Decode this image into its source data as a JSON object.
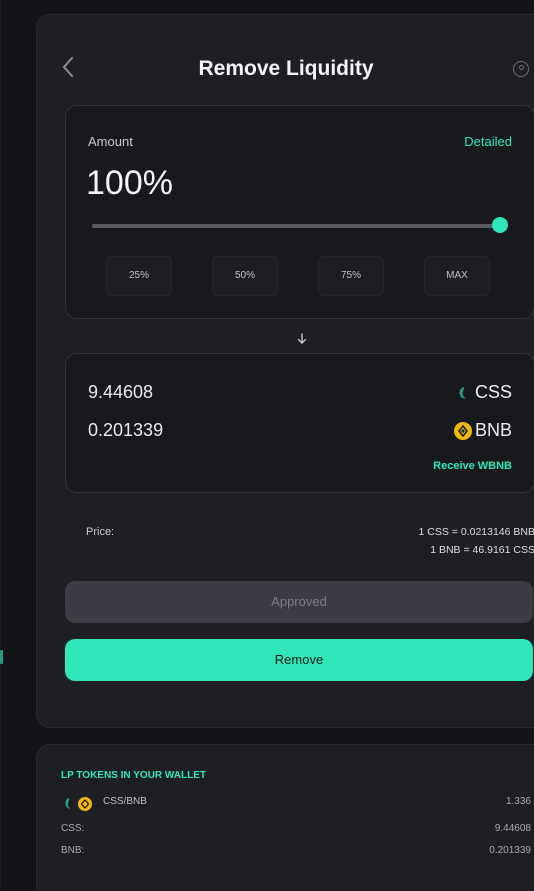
{
  "header": {
    "title": "Remove Liquidity",
    "back_icon": "chevron-left-icon",
    "help_icon": "help-circle-icon"
  },
  "amount": {
    "label": "Amount",
    "detailed_link": "Detailed",
    "value": "100%",
    "slider_percent": 100,
    "presets": [
      "25%",
      "50%",
      "75%",
      "MAX"
    ]
  },
  "receive": {
    "tokens": [
      {
        "amount": "9.44608",
        "symbol": "CSS",
        "icon": "css-token-icon"
      },
      {
        "amount": "0.201339",
        "symbol": "BNB",
        "icon": "bnb-token-icon"
      }
    ],
    "receive_wbnb_link": "Receive WBNB"
  },
  "price": {
    "label": "Price:",
    "lines": [
      "1 CSS = 0.0213146 BNB",
      "1 BNB = 46.9161 CSS"
    ]
  },
  "buttons": {
    "approved": "Approved",
    "remove": "Remove"
  },
  "lp_wallet": {
    "title": "LP TOKENS IN YOUR WALLET",
    "pair": "CSS/BNB",
    "pair_value": "1.336",
    "rows": [
      {
        "label": "CSS:",
        "value": "9.44608"
      },
      {
        "label": "BNB:",
        "value": "0.201339"
      }
    ]
  },
  "colors": {
    "accent": "#2ee6b8",
    "background": "#131417",
    "panel": "#1e1f23",
    "card": "#18191c",
    "bnb": "#f0b90b",
    "approved_button": "#3d3c45"
  }
}
